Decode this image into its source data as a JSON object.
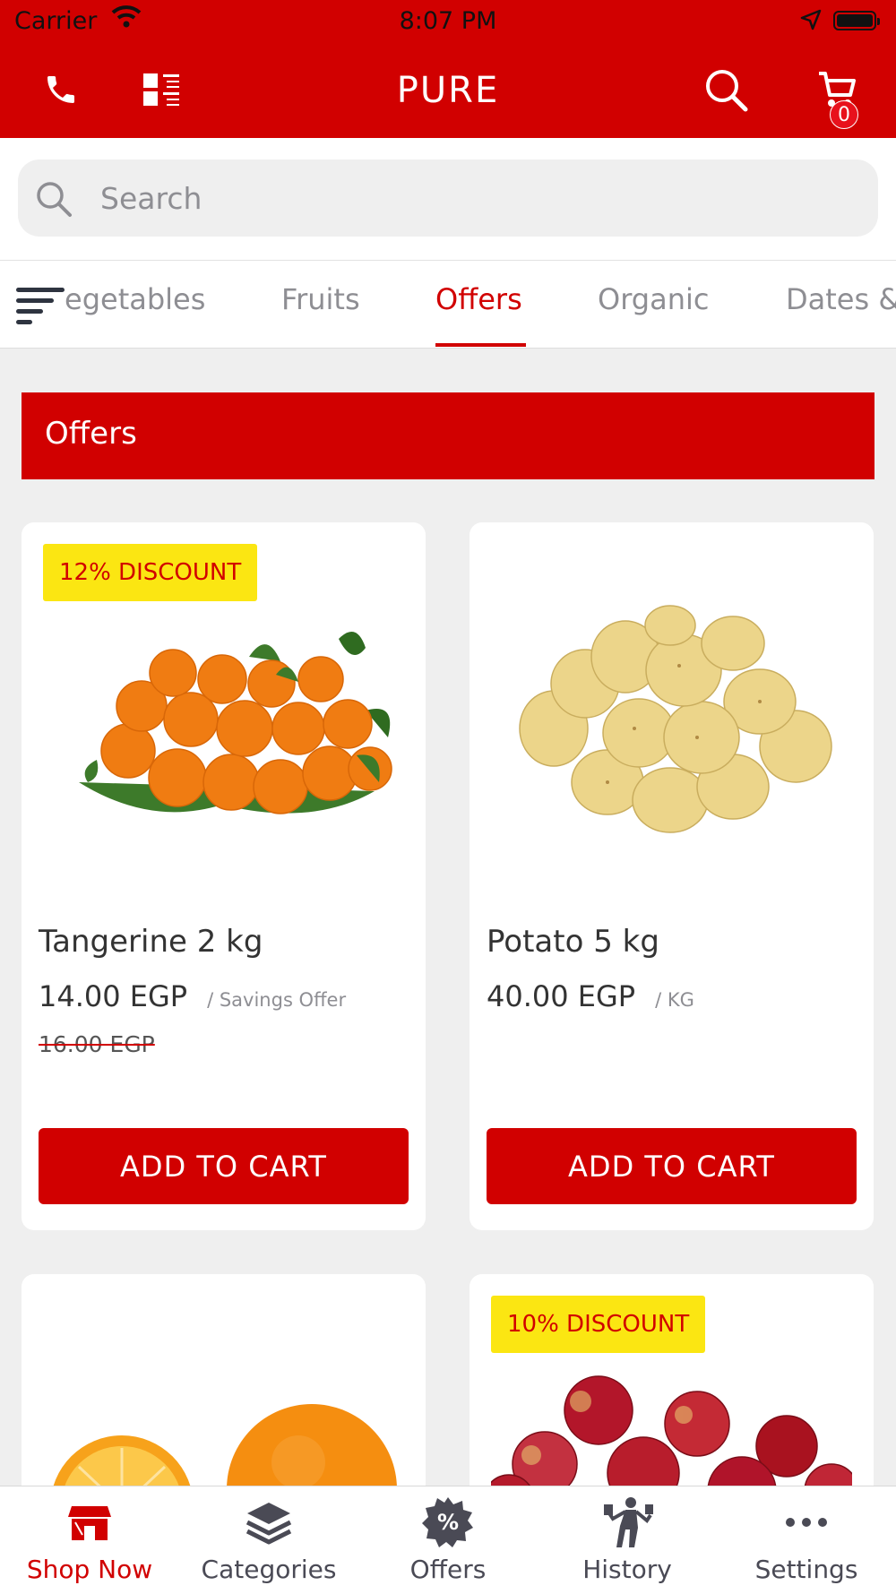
{
  "status_bar": {
    "carrier": "Carrier",
    "time": "8:07 PM"
  },
  "nav": {
    "title": "PURE",
    "cart_count": "0"
  },
  "search": {
    "placeholder": "Search"
  },
  "category_tabs": [
    {
      "label": "egetables"
    },
    {
      "label": "Fruits"
    },
    {
      "label": "Offers",
      "active": true
    },
    {
      "label": "Organic"
    },
    {
      "label": "Dates &"
    }
  ],
  "section": {
    "title": "Offers"
  },
  "products": [
    {
      "badge": "12% DISCOUNT",
      "name": "Tangerine 2 kg",
      "price": "14.00 EGP",
      "unit": "/ Savings Offer",
      "old_price": "16.00 EGP",
      "button": "ADD TO CART",
      "image": "tangerines"
    },
    {
      "badge": "",
      "name": "Potato 5 kg",
      "price": "40.00 EGP",
      "unit": "/ KG",
      "old_price": "",
      "button": "ADD TO CART",
      "image": "potatoes"
    },
    {
      "badge": "",
      "image": "oranges"
    },
    {
      "badge": "10% DISCOUNT",
      "image": "apples"
    }
  ],
  "bottom_tabs": [
    {
      "label": "Shop Now",
      "icon": "store-icon",
      "active": true
    },
    {
      "label": "Categories",
      "icon": "layers-icon"
    },
    {
      "label": "Offers",
      "icon": "percent-badge-icon"
    },
    {
      "label": "History",
      "icon": "shopper-icon"
    },
    {
      "label": "Settings",
      "icon": "more-dots-icon"
    }
  ],
  "colors": {
    "brand_red": "#d10000",
    "badge_yellow": "#fbe612",
    "inactive_gray": "#8e8e93"
  }
}
